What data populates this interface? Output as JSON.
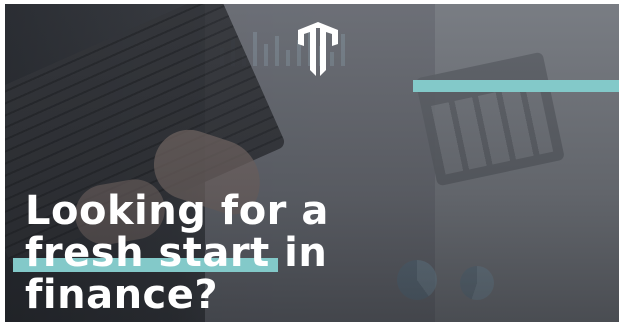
{
  "banner": {
    "headline_line1": "Looking for a",
    "headline_line2_highlight": "fresh start",
    "headline_line2_rest": " in",
    "headline_line3": "finance?",
    "logo_icon": "stacked-m-logo-icon",
    "accent_color": "#83c9c9",
    "text_color": "#ffffff"
  }
}
